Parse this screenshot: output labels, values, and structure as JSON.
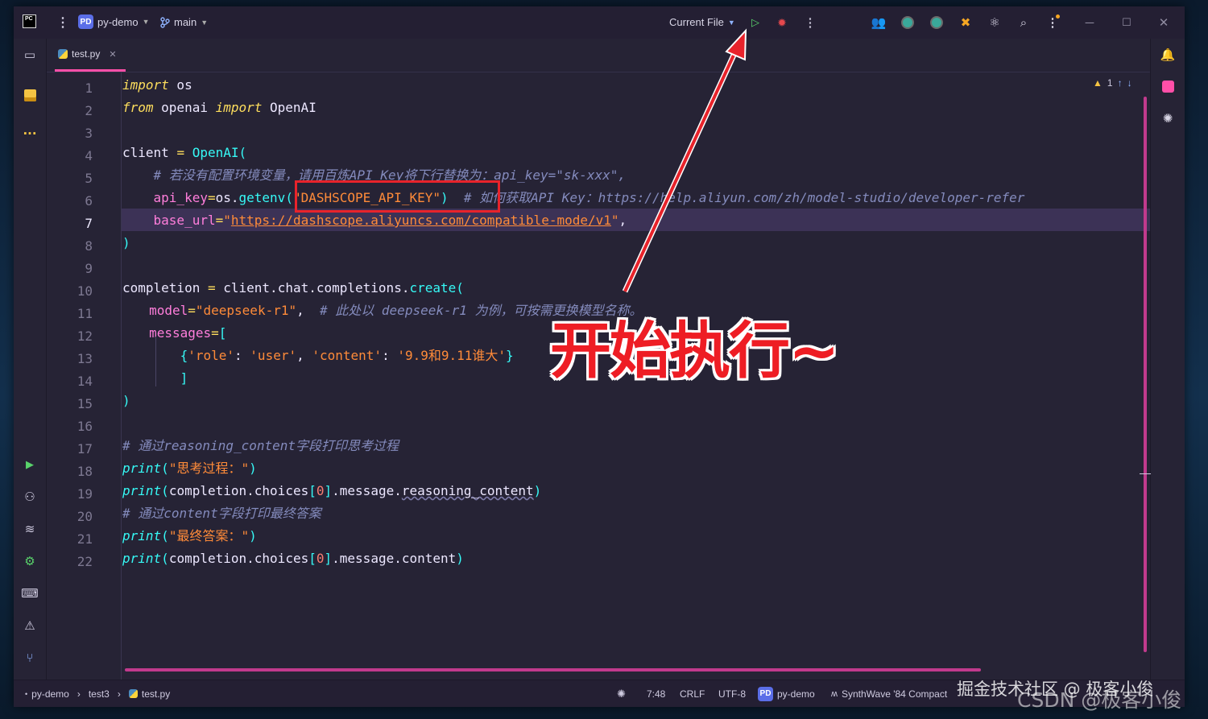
{
  "titlebar": {
    "project_badge": "PD",
    "project": "py-demo",
    "branch": "main",
    "run_config": "Current File"
  },
  "tab": {
    "filename": "test.py"
  },
  "inspections": {
    "warnings": "1"
  },
  "code_lines": [
    {
      "n": "1"
    },
    {
      "n": "2"
    },
    {
      "n": "3"
    },
    {
      "n": "4"
    },
    {
      "n": "5"
    },
    {
      "n": "6"
    },
    {
      "n": "7"
    },
    {
      "n": "8"
    },
    {
      "n": "9"
    },
    {
      "n": "10"
    },
    {
      "n": "11"
    },
    {
      "n": "12"
    },
    {
      "n": "13"
    },
    {
      "n": "14"
    },
    {
      "n": "15"
    },
    {
      "n": "16"
    },
    {
      "n": "17"
    },
    {
      "n": "18"
    },
    {
      "n": "19"
    },
    {
      "n": "20"
    },
    {
      "n": "21"
    },
    {
      "n": "22"
    }
  ],
  "code": {
    "l1": [
      "import",
      " os"
    ],
    "l2": [
      "from",
      " openai ",
      "import",
      " OpenAI"
    ],
    "l4": [
      "client ",
      "=",
      " ",
      "OpenAI",
      "("
    ],
    "l5": "    # 若没有配置环境变量，请用百炼API Key将下行替换为：api_key=\"sk-xxx\",",
    "l6": [
      "    api_key",
      "=",
      "os",
      ".",
      "getenv",
      "(",
      "\"DASHSCOPE_API_KEY\"",
      ")",
      "  # 如何获取API Key：https://help.aliyun.com/zh/model-studio/developer-refer"
    ],
    "l7": [
      "    base_url",
      "=",
      "\"",
      "https://dashscope.aliyuncs.com/compatible-mode/v1",
      "\"",
      ","
    ],
    "l8": ")",
    "l10": [
      "completion ",
      "=",
      " client",
      ".",
      "chat",
      ".",
      "completions",
      ".",
      "create",
      "("
    ],
    "l11": [
      "        model",
      "=",
      "\"deepseek-r1\"",
      ",",
      "  # 此处以 deepseek-r1 为例，可按需更换模型名称。"
    ],
    "l12": [
      "        messages",
      "=",
      "["
    ],
    "l13": [
      "            {",
      "'role'",
      ": ",
      "'user'",
      ", ",
      "'content'",
      ": ",
      "'9.9和9.11谁大'",
      "}"
    ],
    "l14": "            ]",
    "l15": ")",
    "l17": "# 通过reasoning_content字段打印思考过程",
    "l18": [
      "print",
      "(",
      "\"思考过程：\"",
      ")"
    ],
    "l19": [
      "print",
      "(",
      "completion",
      ".",
      "choices",
      "[",
      "0",
      "]",
      ".",
      "message",
      ".",
      "reasoning_content",
      ")"
    ],
    "l20": "# 通过content字段打印最终答案",
    "l21": [
      "print",
      "(",
      "\"最终答案：\"",
      ")"
    ],
    "l22": [
      "print",
      "(",
      "completion",
      ".",
      "choices",
      "[",
      "0",
      "]",
      ".",
      "message",
      ".",
      "content",
      ")"
    ]
  },
  "annotation": "开始执行~",
  "statusbar": {
    "crumb1": "py-demo",
    "crumb2": "test3",
    "crumb3": "test.py",
    "position": "7:48",
    "line_sep": "CRLF",
    "encoding": "UTF-8",
    "interp_badge": "PD",
    "interpreter": "py-demo",
    "theme": "SynthWave '84 Compact"
  },
  "watermarks": {
    "w1": "掘金技术社区 @ 极客小俊",
    "w2": "CSDN @极客小俊"
  },
  "colors": {
    "accent_pink": "#ff4fa8",
    "highlight_red": "#e8232b",
    "keyword": "#fede5d",
    "string": "#ff8b39",
    "function": "#36f9f6"
  }
}
